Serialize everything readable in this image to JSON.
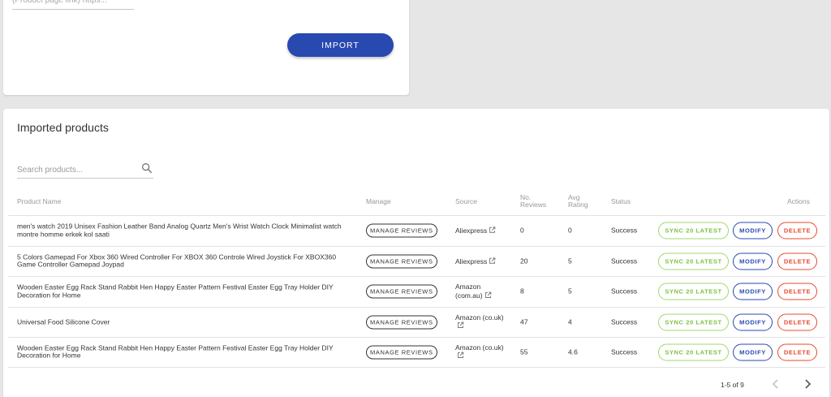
{
  "import_panel": {
    "link_placeholder": "(Product page link) https...",
    "import_label": "IMPORT"
  },
  "products_panel": {
    "title": "Imported products",
    "search_placeholder": "Search products...",
    "columns": {
      "product_name": "Product Name",
      "manage": "Manage",
      "source": "Source",
      "reviews": "No. Reviews",
      "rating": "Avg Rating",
      "status": "Status",
      "actions": "Actions"
    },
    "rows": [
      {
        "name": "men's watch 2019 Unisex Fashion Leather Band Analog Quartz Men's Wrist Watch Clock Minimalist watch montre homme erkek kol saati",
        "manage_label": "MANAGE REVIEWS",
        "source": "Aliexpress",
        "reviews": "0",
        "rating": "0",
        "status": "Success",
        "sync_label": "SYNC 20 LATEST",
        "modify_label": "MODIFY",
        "delete_label": "DELETE"
      },
      {
        "name": "5 Colors Gamepad For Xbox 360 Wired Controller For XBOX 360 Controle Wired Joystick For XBOX360 Game Controller Gamepad Joypad",
        "manage_label": "MANAGE REVIEWS",
        "source": "Aliexpress",
        "reviews": "20",
        "rating": "5",
        "status": "Success",
        "sync_label": "SYNC 20 LATEST",
        "modify_label": "MODIFY",
        "delete_label": "DELETE"
      },
      {
        "name": "Wooden Easter Egg Rack Stand Rabbit Hen Happy Easter Pattern Festival Easter Egg Tray Holder DIY Decoration for Home",
        "manage_label": "MANAGE REVIEWS",
        "source": "Amazon (com.au)",
        "reviews": "8",
        "rating": "5",
        "status": "Success",
        "sync_label": "SYNC 20 LATEST",
        "modify_label": "MODIFY",
        "delete_label": "DELETE"
      },
      {
        "name": "Universal Food Silicone Cover",
        "manage_label": "MANAGE REVIEWS",
        "source": "Amazon (co.uk)",
        "reviews": "47",
        "rating": "4",
        "status": "Success",
        "sync_label": "SYNC 20 LATEST",
        "modify_label": "MODIFY",
        "delete_label": "DELETE"
      },
      {
        "name": "Wooden Easter Egg Rack Stand Rabbit Hen Happy Easter Pattern Festival Easter Egg Tray Holder DIY Decoration for Home",
        "manage_label": "MANAGE REVIEWS",
        "source": "Amazon (co.uk)",
        "reviews": "55",
        "rating": "4.6",
        "status": "Success",
        "sync_label": "SYNC 20 LATEST",
        "modify_label": "MODIFY",
        "delete_label": "DELETE"
      }
    ],
    "pagination": {
      "range_label": "1-5 of 9",
      "prev_icon": "chevron-left-icon",
      "next_icon": "chevron-right-icon"
    }
  },
  "colors": {
    "primary": "#2849b0",
    "sync_green": "#7cc242",
    "delete_red": "#e8492f",
    "background": "#e6e6e6"
  }
}
